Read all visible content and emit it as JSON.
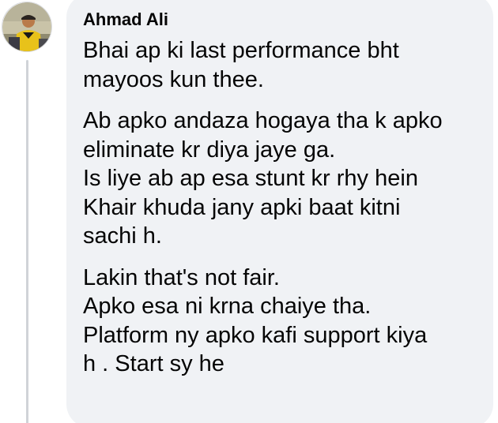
{
  "comment": {
    "author": "Ahmad Ali",
    "paragraphs": [
      [
        "Bhai ap ki last performance bht",
        "mayoos kun thee."
      ],
      [
        "Ab apko andaza hogaya tha k apko",
        "eliminate kr diya jaye ga.",
        "Is liye ab ap esa stunt kr rhy hein",
        "Khair khuda jany apki baat kitni",
        "sachi h."
      ],
      [
        "Lakin that's not fair.",
        "Apko esa ni krna chaiye tha.",
        "Platform ny apko kafi support kiya",
        "h . Start sy he"
      ]
    ]
  },
  "colors": {
    "bubble_background": "#f0f2f5",
    "text": "#050505",
    "thread_line": "#d0d3d8"
  },
  "icons": {
    "avatar": "profile-photo-avatar"
  }
}
